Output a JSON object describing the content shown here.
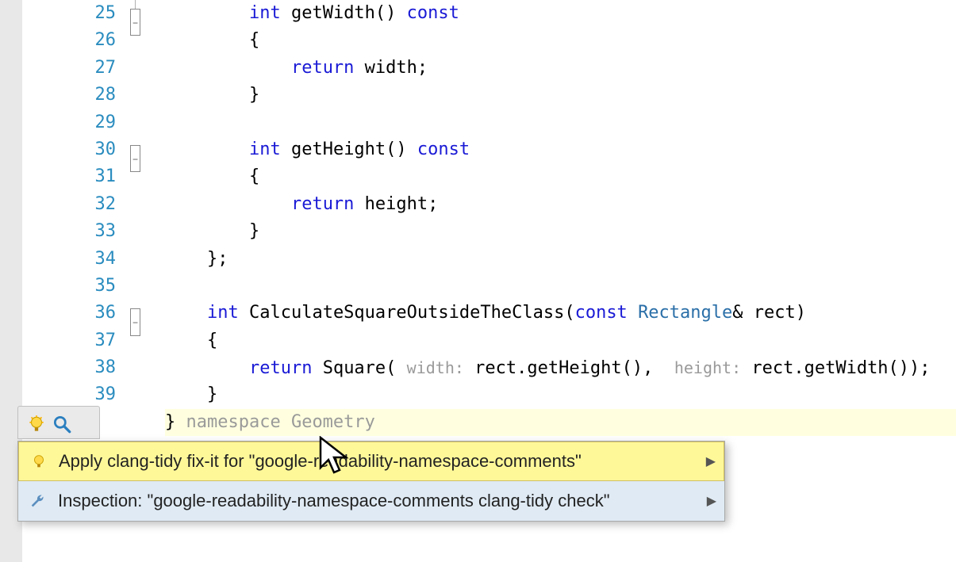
{
  "lines": [
    {
      "n": "25",
      "fold": "box",
      "tokens": [
        {
          "t": "        ",
          "c": ""
        },
        {
          "t": "int",
          "c": "kw"
        },
        {
          "t": " getWidth() ",
          "c": ""
        },
        {
          "t": "const",
          "c": "kw"
        }
      ]
    },
    {
      "n": "26",
      "tokens": [
        {
          "t": "        {",
          "c": ""
        }
      ]
    },
    {
      "n": "27",
      "tokens": [
        {
          "t": "            ",
          "c": ""
        },
        {
          "t": "return",
          "c": "kw"
        },
        {
          "t": " width;",
          "c": ""
        }
      ]
    },
    {
      "n": "28",
      "tokens": [
        {
          "t": "        }",
          "c": ""
        }
      ]
    },
    {
      "n": "29",
      "tokens": []
    },
    {
      "n": "30",
      "fold": "box",
      "tokens": [
        {
          "t": "        ",
          "c": ""
        },
        {
          "t": "int",
          "c": "kw"
        },
        {
          "t": " getHeight() ",
          "c": ""
        },
        {
          "t": "const",
          "c": "kw"
        }
      ]
    },
    {
      "n": "31",
      "tokens": [
        {
          "t": "        {",
          "c": ""
        }
      ]
    },
    {
      "n": "32",
      "tokens": [
        {
          "t": "            ",
          "c": ""
        },
        {
          "t": "return",
          "c": "kw"
        },
        {
          "t": " height;",
          "c": ""
        }
      ]
    },
    {
      "n": "33",
      "tokens": [
        {
          "t": "        }",
          "c": ""
        }
      ]
    },
    {
      "n": "34",
      "tokens": [
        {
          "t": "    };",
          "c": ""
        }
      ]
    },
    {
      "n": "35",
      "tokens": []
    },
    {
      "n": "36",
      "fold": "box",
      "tokens": [
        {
          "t": "    ",
          "c": ""
        },
        {
          "t": "int",
          "c": "kw"
        },
        {
          "t": " CalculateSquareOutsideTheClass(",
          "c": ""
        },
        {
          "t": "const",
          "c": "kw"
        },
        {
          "t": " ",
          "c": ""
        },
        {
          "t": "Rectangle",
          "c": "type"
        },
        {
          "t": "& rect)",
          "c": ""
        }
      ]
    },
    {
      "n": "37",
      "tokens": [
        {
          "t": "    {",
          "c": ""
        }
      ]
    },
    {
      "n": "38",
      "tokens": [
        {
          "t": "        ",
          "c": ""
        },
        {
          "t": "return",
          "c": "kw"
        },
        {
          "t": " Square( ",
          "c": ""
        },
        {
          "t": "width:",
          "c": "hint"
        },
        {
          "t": " rect.getHeight(),  ",
          "c": ""
        },
        {
          "t": "height:",
          "c": "hint"
        },
        {
          "t": " rect.getWidth());",
          "c": ""
        }
      ]
    },
    {
      "n": "39",
      "tokens": [
        {
          "t": "    }",
          "c": ""
        }
      ]
    },
    {
      "n": "",
      "hl": true,
      "tokens": [
        {
          "t": "} ",
          "c": ""
        },
        {
          "t": "namespace Geometry",
          "c": "comment-hint"
        }
      ]
    }
  ],
  "popup": {
    "items": [
      {
        "label": "Apply clang-tidy fix-it for \"google-readability-namespace-comments\"",
        "icon": "bulb",
        "sel": true
      },
      {
        "label": "Inspection: \"google-readability-namespace-comments clang-tidy check\"",
        "icon": "wrench",
        "sel": false
      }
    ]
  }
}
